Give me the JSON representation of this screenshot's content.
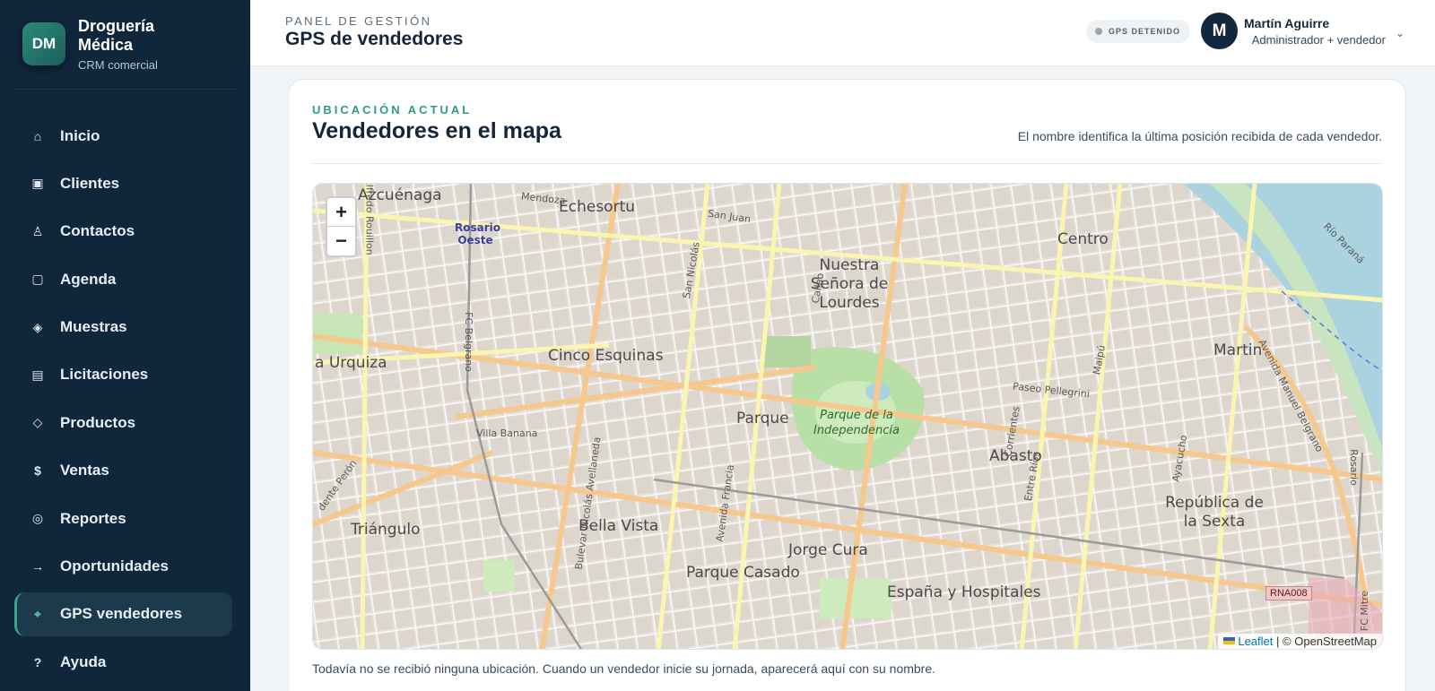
{
  "brand": {
    "initials": "DM",
    "name": "Droguería Médica",
    "subtitle": "CRM comercial"
  },
  "sidebar": {
    "items": [
      {
        "label": "Inicio",
        "icon": "home-icon",
        "glyph": "⌂"
      },
      {
        "label": "Clientes",
        "icon": "building-icon",
        "glyph": "▣"
      },
      {
        "label": "Contactos",
        "icon": "person-icon",
        "glyph": "♙"
      },
      {
        "label": "Agenda",
        "icon": "calendar-icon",
        "glyph": "▢"
      },
      {
        "label": "Muestras",
        "icon": "diamond-icon",
        "glyph": "◈"
      },
      {
        "label": "Licitaciones",
        "icon": "document-icon",
        "glyph": "▤"
      },
      {
        "label": "Productos",
        "icon": "tag-icon",
        "glyph": "◇"
      },
      {
        "label": "Ventas",
        "icon": "dollar-icon",
        "glyph": "$"
      },
      {
        "label": "Reportes",
        "icon": "chart-icon",
        "glyph": "◎"
      },
      {
        "label": "Oportunidades",
        "icon": "arrow-right-icon",
        "glyph": "→"
      },
      {
        "label": "GPS vendedores",
        "icon": "gps-icon",
        "glyph": "⌖",
        "active": true
      },
      {
        "label": "Ayuda",
        "icon": "help-icon",
        "glyph": "?"
      }
    ]
  },
  "header": {
    "kicker": "PANEL DE GESTIÓN",
    "title": "GPS de vendedores",
    "gps_status": "GPS DETENIDO",
    "user_initial": "M",
    "user_name": "Martín Aguirre",
    "user_role": "Administrador + vendedor"
  },
  "card": {
    "kicker": "UBICACIÓN ACTUAL",
    "title": "Vendedores en el mapa",
    "hint": "El nombre identifica la última posición recibida de cada vendedor.",
    "footer": "Todavía no se recibió ninguna ubicación. Cuando un vendedor inicie su jornada, aparecerá aquí con su nombre."
  },
  "map": {
    "zoom_in": "+",
    "zoom_out": "−",
    "attribution_leaflet": "Leaflet",
    "attribution_sep": "|",
    "attribution_osm": "© OpenStreetMap",
    "labels": [
      "Azcuénaga",
      "Echesortu",
      "Rosario Oeste",
      "Centro",
      "Nuestra Señora de Lourdes",
      "Cinco Esquinas",
      "Martin",
      "Parque",
      "Parque de la Independencia",
      "Abasto",
      "Villa Banana",
      "Bella Vista",
      "Triángulo",
      "Jorge Cura",
      "Parque Casado",
      "República de la Sexta",
      "España y Hospitales",
      "a Urquiza",
      "Paseo Pellegrini",
      "Mendoza",
      "San Juan",
      "San Nicolás",
      "Callao",
      "Corrientes",
      "Entre Ríos",
      "Maipú",
      "Ayacucho",
      "Avenida Francia",
      "Bulevar Nicolás Avellaneda",
      "Avenida Manuel Belgrano",
      "FC Belgrano",
      "Río Paraná",
      "Alfredo Rouillon",
      "dente Perón",
      "Rosario",
      "FC Mitre"
    ],
    "rna_label": "RNA008"
  }
}
